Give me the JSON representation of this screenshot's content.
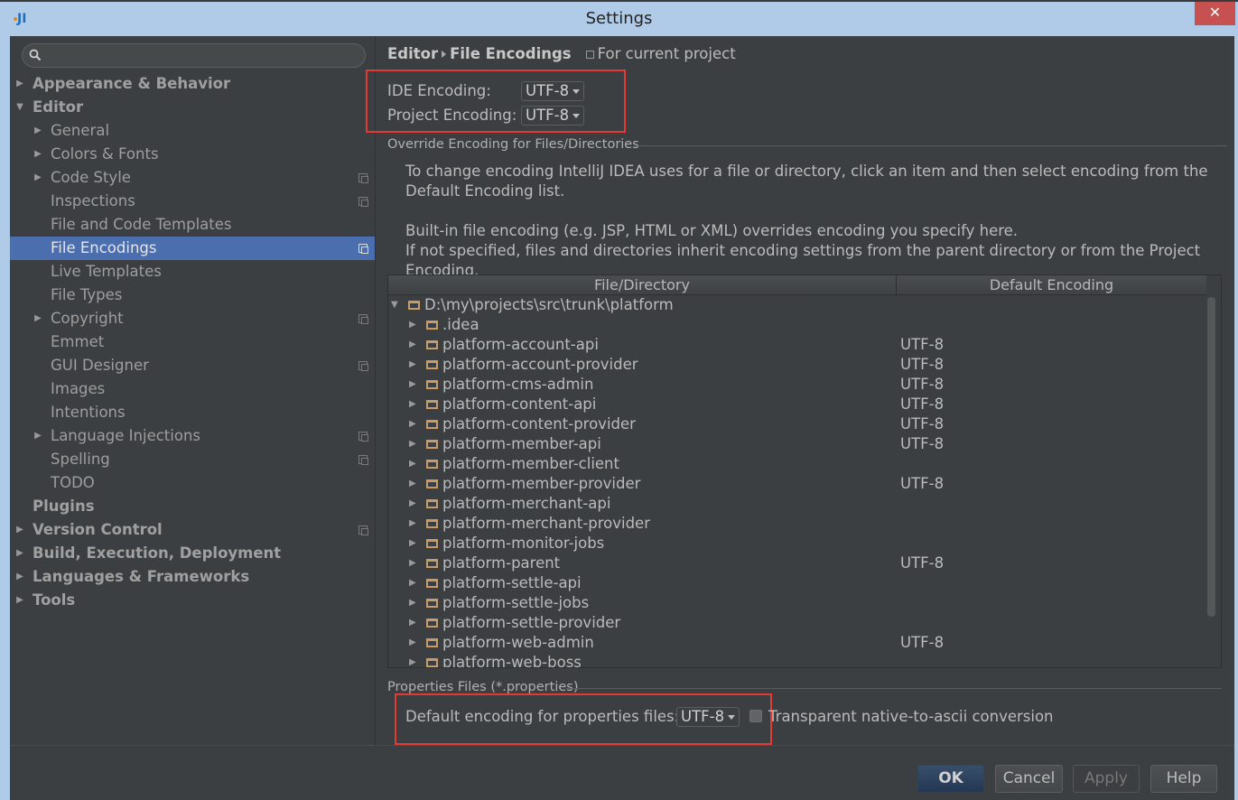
{
  "window": {
    "title": "Settings",
    "app_icon": "intellij-idea-icon",
    "close_icon": "close-icon"
  },
  "sidebar": {
    "search": {
      "placeholder": "",
      "value": ""
    },
    "items": [
      {
        "label": "Appearance & Behavior",
        "level": 0,
        "arrow": "right",
        "project": false,
        "selected": false
      },
      {
        "label": "Editor",
        "level": 0,
        "arrow": "down",
        "project": false,
        "selected": false
      },
      {
        "label": "General",
        "level": 1,
        "arrow": "right",
        "project": false,
        "selected": false
      },
      {
        "label": "Colors & Fonts",
        "level": 1,
        "arrow": "right",
        "project": false,
        "selected": false
      },
      {
        "label": "Code Style",
        "level": 1,
        "arrow": "right",
        "project": true,
        "selected": false
      },
      {
        "label": "Inspections",
        "level": 1,
        "arrow": "",
        "project": true,
        "selected": false
      },
      {
        "label": "File and Code Templates",
        "level": 1,
        "arrow": "",
        "project": false,
        "selected": false
      },
      {
        "label": "File Encodings",
        "level": 1,
        "arrow": "",
        "project": true,
        "selected": true
      },
      {
        "label": "Live Templates",
        "level": 1,
        "arrow": "",
        "project": false,
        "selected": false
      },
      {
        "label": "File Types",
        "level": 1,
        "arrow": "",
        "project": false,
        "selected": false
      },
      {
        "label": "Copyright",
        "level": 1,
        "arrow": "right",
        "project": true,
        "selected": false
      },
      {
        "label": "Emmet",
        "level": 1,
        "arrow": "",
        "project": false,
        "selected": false
      },
      {
        "label": "GUI Designer",
        "level": 1,
        "arrow": "",
        "project": true,
        "selected": false
      },
      {
        "label": "Images",
        "level": 1,
        "arrow": "",
        "project": false,
        "selected": false
      },
      {
        "label": "Intentions",
        "level": 1,
        "arrow": "",
        "project": false,
        "selected": false
      },
      {
        "label": "Language Injections",
        "level": 1,
        "arrow": "right",
        "project": true,
        "selected": false
      },
      {
        "label": "Spelling",
        "level": 1,
        "arrow": "",
        "project": true,
        "selected": false
      },
      {
        "label": "TODO",
        "level": 1,
        "arrow": "",
        "project": false,
        "selected": false
      },
      {
        "label": "Plugins",
        "level": 0,
        "arrow": "",
        "project": false,
        "selected": false
      },
      {
        "label": "Version Control",
        "level": 0,
        "arrow": "right",
        "project": true,
        "selected": false
      },
      {
        "label": "Build, Execution, Deployment",
        "level": 0,
        "arrow": "right",
        "project": false,
        "selected": false
      },
      {
        "label": "Languages & Frameworks",
        "level": 0,
        "arrow": "right",
        "project": false,
        "selected": false
      },
      {
        "label": "Tools",
        "level": 0,
        "arrow": "right",
        "project": false,
        "selected": false
      }
    ]
  },
  "main": {
    "breadcrumb": {
      "parent": "Editor",
      "current": "File Encodings",
      "scope_note": "For current project"
    },
    "ide_encoding": {
      "label": "IDE Encoding:",
      "value": "UTF-8"
    },
    "project_encoding": {
      "label": "Project Encoding:",
      "value": "UTF-8"
    },
    "override_section_title": "Override Encoding for Files/Directories",
    "info_line1": "To change encoding IntelliJ IDEA uses for a file or directory, click an item and then select encoding from the Default Encoding list.",
    "info_line2": "Built-in file encoding (e.g. JSP, HTML or XML) overrides encoding you specify here.",
    "info_line3": "If not specified, files and directories inherit encoding settings from the parent directory or from the Project Encoding.",
    "table": {
      "columns": [
        "File/Directory",
        "Default Encoding"
      ],
      "root": {
        "name": "D:\\my\\projects\\src\\trunk\\platform",
        "encoding": ""
      },
      "rows": [
        {
          "name": ".idea",
          "encoding": ""
        },
        {
          "name": "platform-account-api",
          "encoding": "UTF-8"
        },
        {
          "name": "platform-account-provider",
          "encoding": "UTF-8"
        },
        {
          "name": "platform-cms-admin",
          "encoding": "UTF-8"
        },
        {
          "name": "platform-content-api",
          "encoding": "UTF-8"
        },
        {
          "name": "platform-content-provider",
          "encoding": "UTF-8"
        },
        {
          "name": "platform-member-api",
          "encoding": "UTF-8"
        },
        {
          "name": "platform-member-client",
          "encoding": ""
        },
        {
          "name": "platform-member-provider",
          "encoding": "UTF-8"
        },
        {
          "name": "platform-merchant-api",
          "encoding": ""
        },
        {
          "name": "platform-merchant-provider",
          "encoding": ""
        },
        {
          "name": "platform-monitor-jobs",
          "encoding": ""
        },
        {
          "name": "platform-parent",
          "encoding": "UTF-8"
        },
        {
          "name": "platform-settle-api",
          "encoding": ""
        },
        {
          "name": "platform-settle-jobs",
          "encoding": ""
        },
        {
          "name": "platform-settle-provider",
          "encoding": ""
        },
        {
          "name": "platform-web-admin",
          "encoding": "UTF-8"
        },
        {
          "name": "platform-web-boss",
          "encoding": ""
        }
      ]
    },
    "properties_section_title": "Properties Files (*.properties)",
    "properties_encoding": {
      "label": "Default encoding for properties files:",
      "value": "UTF-8"
    },
    "native_to_ascii": {
      "label": "Transparent native-to-ascii conversion",
      "checked": false
    }
  },
  "footer": {
    "ok": "OK",
    "cancel": "Cancel",
    "apply": "Apply",
    "help": "Help"
  },
  "colors": {
    "selection": "#4b6eaf",
    "highlight_box": "#e53935",
    "folder": "#c69c6d",
    "close_button": "#c75050"
  }
}
